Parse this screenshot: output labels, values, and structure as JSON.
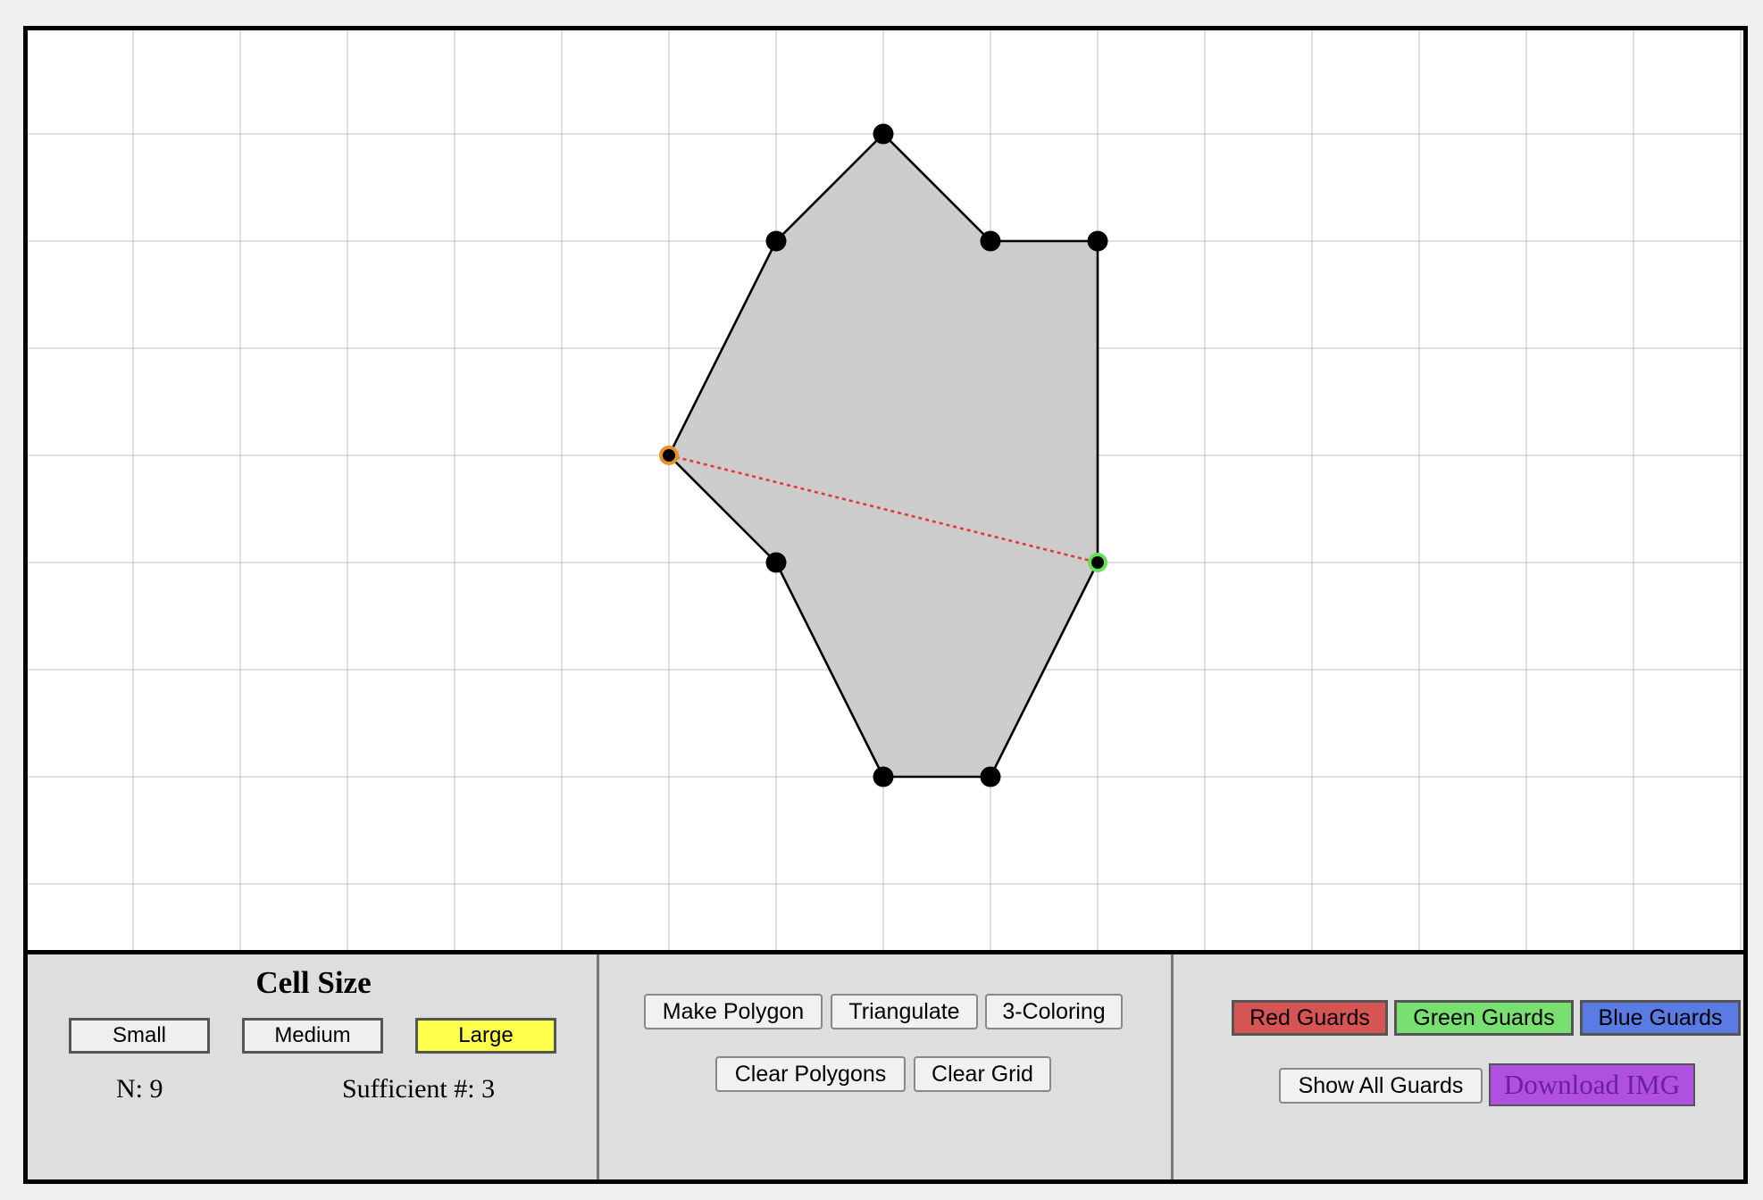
{
  "cell_size": {
    "title": "Cell Size",
    "options": [
      {
        "label": "Small",
        "active": false
      },
      {
        "label": "Medium",
        "active": false
      },
      {
        "label": "Large",
        "active": true
      }
    ],
    "active_color": "#ffff4d"
  },
  "stats": {
    "n_label": "N: 9",
    "sufficient_label": "Sufficient #: 3"
  },
  "polygon_controls": {
    "make_polygon": "Make Polygon",
    "triangulate": "Triangulate",
    "three_coloring": "3-Coloring",
    "clear_polygons": "Clear Polygons",
    "clear_grid": "Clear Grid"
  },
  "guard_controls": {
    "red": {
      "label": "Red Guards",
      "color": "#d65454"
    },
    "green": {
      "label": "Green Guards",
      "color": "#78e070"
    },
    "blue": {
      "label": "Blue Guards",
      "color": "#5a7ae4"
    },
    "show_all": "Show All Guards",
    "download": {
      "label": "Download IMG",
      "color": "#b050e0",
      "text_color": "#6a1fa0"
    }
  },
  "canvas": {
    "grid_color": "#cccccc",
    "polygon_fill": "#cccccc",
    "polygon_stroke": "#000000",
    "vertices": [
      [
        8,
        1
      ],
      [
        9,
        2
      ],
      [
        10,
        2
      ],
      [
        10,
        5
      ],
      [
        9,
        7
      ],
      [
        8,
        7
      ],
      [
        7,
        5
      ],
      [
        6,
        4
      ],
      [
        7,
        2
      ]
    ],
    "diagonal": {
      "from": [
        6,
        4
      ],
      "to": [
        10,
        5
      ],
      "color": "#e53935"
    },
    "highlight_start": {
      "at": [
        6,
        4
      ],
      "color": "#e8902a"
    },
    "highlight_end": {
      "at": [
        10,
        5
      ],
      "color": "#66e05a"
    }
  }
}
